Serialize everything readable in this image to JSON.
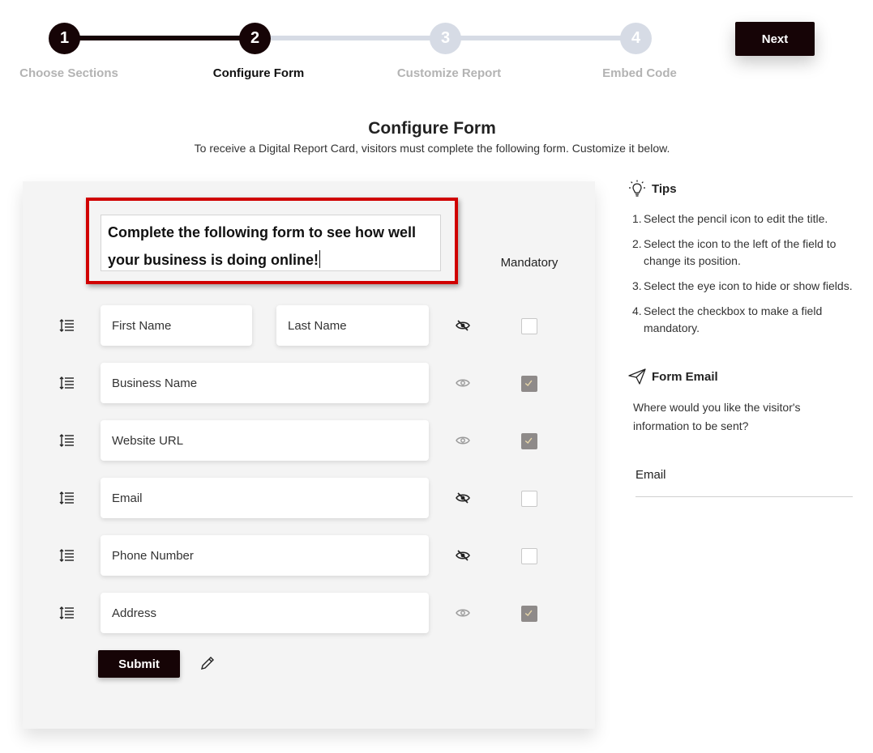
{
  "stepper": {
    "steps": [
      {
        "number": "1",
        "label": "Choose Sections",
        "state": "done"
      },
      {
        "number": "2",
        "label": "Configure Form",
        "state": "current"
      },
      {
        "number": "3",
        "label": "Customize Report",
        "state": "todo"
      },
      {
        "number": "4",
        "label": "Embed Code",
        "state": "todo"
      }
    ],
    "next_label": "Next"
  },
  "header": {
    "title": "Configure Form",
    "subtitle": "To receive a Digital Report Card, visitors must complete the following form. Customize it below."
  },
  "form": {
    "title_text": "Complete the following form to see how well your business is doing online!",
    "mandatory_header": "Mandatory",
    "rows": [
      {
        "fields": [
          "First Name",
          "Last Name"
        ],
        "visible": false,
        "mandatory": false
      },
      {
        "fields": [
          "Business Name"
        ],
        "visible": true,
        "mandatory": true
      },
      {
        "fields": [
          "Website URL"
        ],
        "visible": true,
        "mandatory": true
      },
      {
        "fields": [
          "Email"
        ],
        "visible": false,
        "mandatory": false
      },
      {
        "fields": [
          "Phone Number"
        ],
        "visible": false,
        "mandatory": false
      },
      {
        "fields": [
          "Address"
        ],
        "visible": true,
        "mandatory": true
      }
    ],
    "submit_label": "Submit"
  },
  "tips": {
    "title": "Tips",
    "items": [
      {
        "n": "1.",
        "text": "Select the pencil icon to edit the title."
      },
      {
        "n": "2.",
        "text": "Select the icon to the left of the field to change its position."
      },
      {
        "n": "3.",
        "text": "Select the eye icon to hide or show fields."
      },
      {
        "n": "4.",
        "text": "Select the checkbox to make a field mandatory."
      }
    ]
  },
  "form_email": {
    "title": "Form Email",
    "question": "Where would you like the visitor's information to be sent?",
    "input_label": "Email"
  },
  "colors": {
    "brand_dark": "#160406",
    "step_inactive": "#d6dbe5",
    "highlight_red": "#d00000",
    "checkbox_checked": "#8e8a89"
  },
  "icons": [
    "drag-handle-icon",
    "eye-icon",
    "eye-off-icon",
    "pencil-icon",
    "lightbulb-icon",
    "paper-plane-icon",
    "checkmark-icon"
  ]
}
